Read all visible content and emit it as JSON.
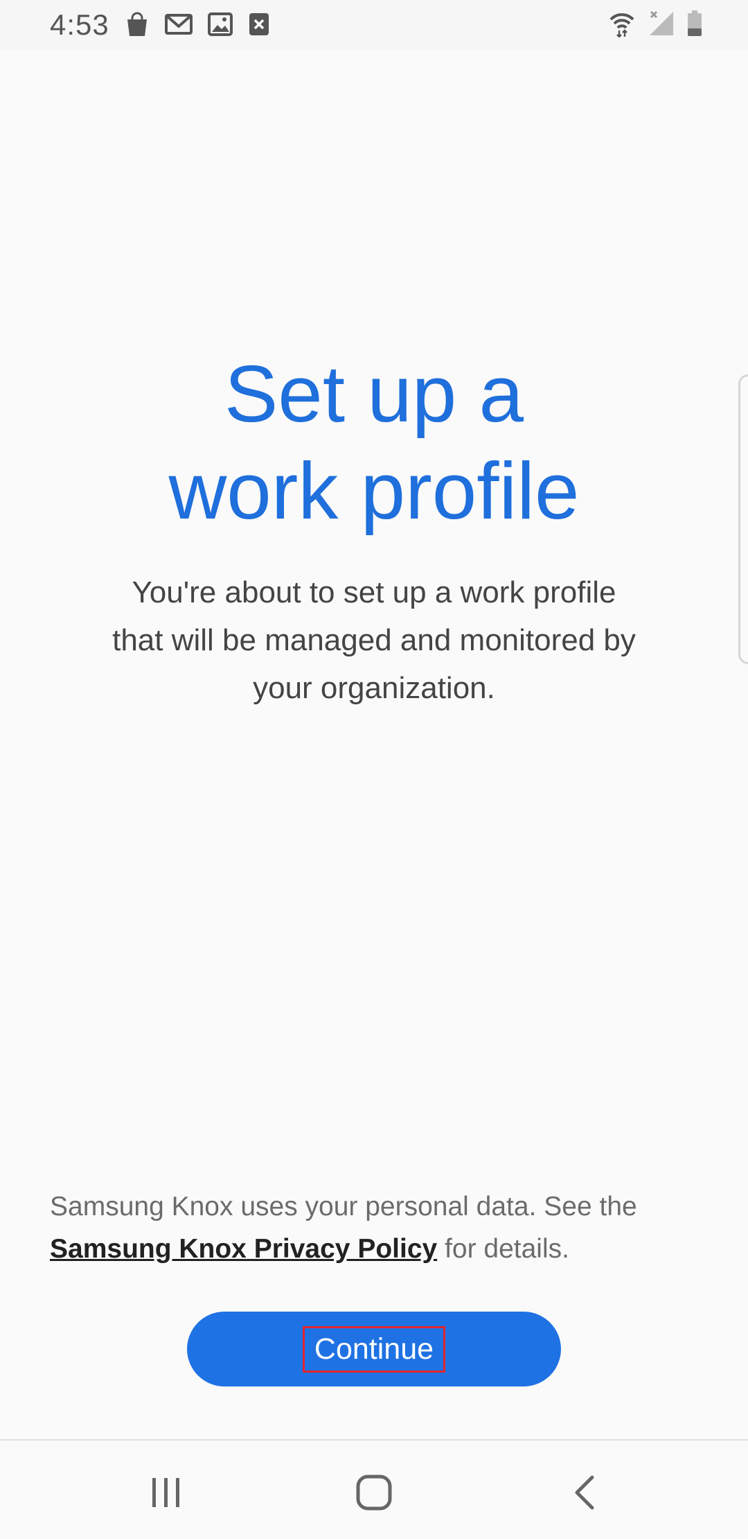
{
  "status_bar": {
    "time": "4:53",
    "left_icons": [
      "shopping-bag-icon",
      "gmail-icon",
      "gallery-icon",
      "close-notification-icon"
    ],
    "right_icons": [
      "wifi-icon",
      "no-signal-icon",
      "battery-icon"
    ]
  },
  "main": {
    "title_line1": "Set up a",
    "title_line2": "work profile",
    "description": "You're about to set up a work profile that will be managed and monitored by your organization."
  },
  "privacy": {
    "text_before": "Samsung Knox uses your personal data. See the ",
    "link_text": "Samsung Knox Privacy Policy",
    "text_after": " for details."
  },
  "actions": {
    "continue_label": "Continue"
  },
  "nav_bar": {
    "buttons": [
      "recent-apps-icon",
      "home-icon",
      "back-icon"
    ]
  },
  "colors": {
    "accent": "#1f72e4",
    "title": "#1f6fdc",
    "background": "#fafafa"
  }
}
